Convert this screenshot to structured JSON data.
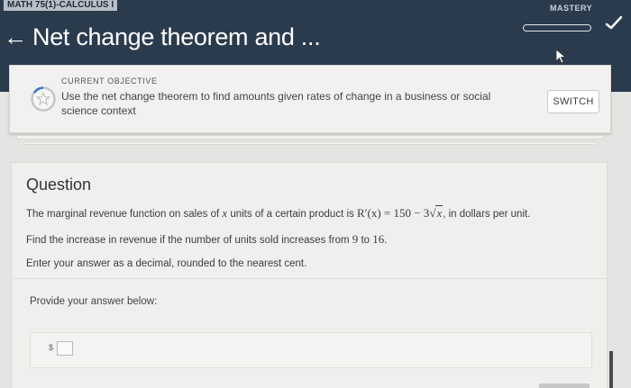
{
  "header": {
    "course_label": "MATH 75(1)-CALCULUS I",
    "back_icon": "back-arrow-icon",
    "title": "Net change theorem and ...",
    "mastery_label": "MASTERY",
    "mastery_progress": 0,
    "colors": {
      "background": "#2b3b4e",
      "text": "#ffffff"
    }
  },
  "objective": {
    "kicker": "CURRENT OBJECTIVE",
    "text": "Use the net change theorem to find amounts given rates of change in a business or social science context",
    "switch_label": "SWITCH"
  },
  "question": {
    "heading": "Question",
    "line1_prefix": "The marginal revenue function on sales of ",
    "line1_var": "x",
    "line1_mid": " units of a certain product is ",
    "line1_fn": "R′(x) = 150 − 3",
    "line1_sqrt": "x",
    "line1_suffix": ", in dollars per unit.",
    "line2_prefix": "Find the increase in revenue if the number of units sold increases from ",
    "line2_from": "9",
    "line2_mid": " to ",
    "line2_to": "16",
    "line2_suffix": ".",
    "line3": "Enter your answer as a decimal, rounded to the nearest cent.",
    "provide_label": "Provide your answer below:",
    "currency_symbol": "$",
    "answer_value": ""
  }
}
